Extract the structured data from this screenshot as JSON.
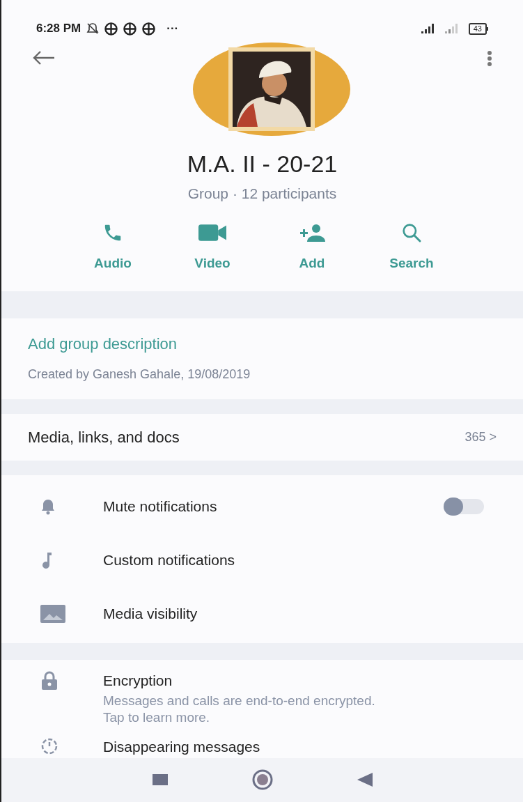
{
  "status_bar": {
    "time": "6:28 PM",
    "more": "···",
    "battery": "43"
  },
  "group": {
    "name": "M.A. II - 20-21",
    "subtitle": "Group · 12 participants"
  },
  "actions": [
    {
      "kind": "audio",
      "label": "Audio"
    },
    {
      "kind": "video",
      "label": "Video"
    },
    {
      "kind": "add",
      "label": "Add"
    },
    {
      "kind": "search",
      "label": "Search"
    }
  ],
  "description": {
    "link": "Add group description",
    "created": "Created by Ganesh Gahale, 19/08/2019"
  },
  "media": {
    "label": "Media, links, and docs",
    "count": "365 >"
  },
  "settings": [
    {
      "kind": "toggle",
      "label": "Mute notifications",
      "on": false
    },
    {
      "kind": "plain",
      "label": "Custom notifications"
    },
    {
      "kind": "plain",
      "label": "Media visibility"
    }
  ],
  "security": [
    {
      "label": "Encryption",
      "detail": "Messages and calls are end-to-end encrypted. Tap to learn more."
    },
    {
      "label": "Disappearing messages"
    }
  ]
}
